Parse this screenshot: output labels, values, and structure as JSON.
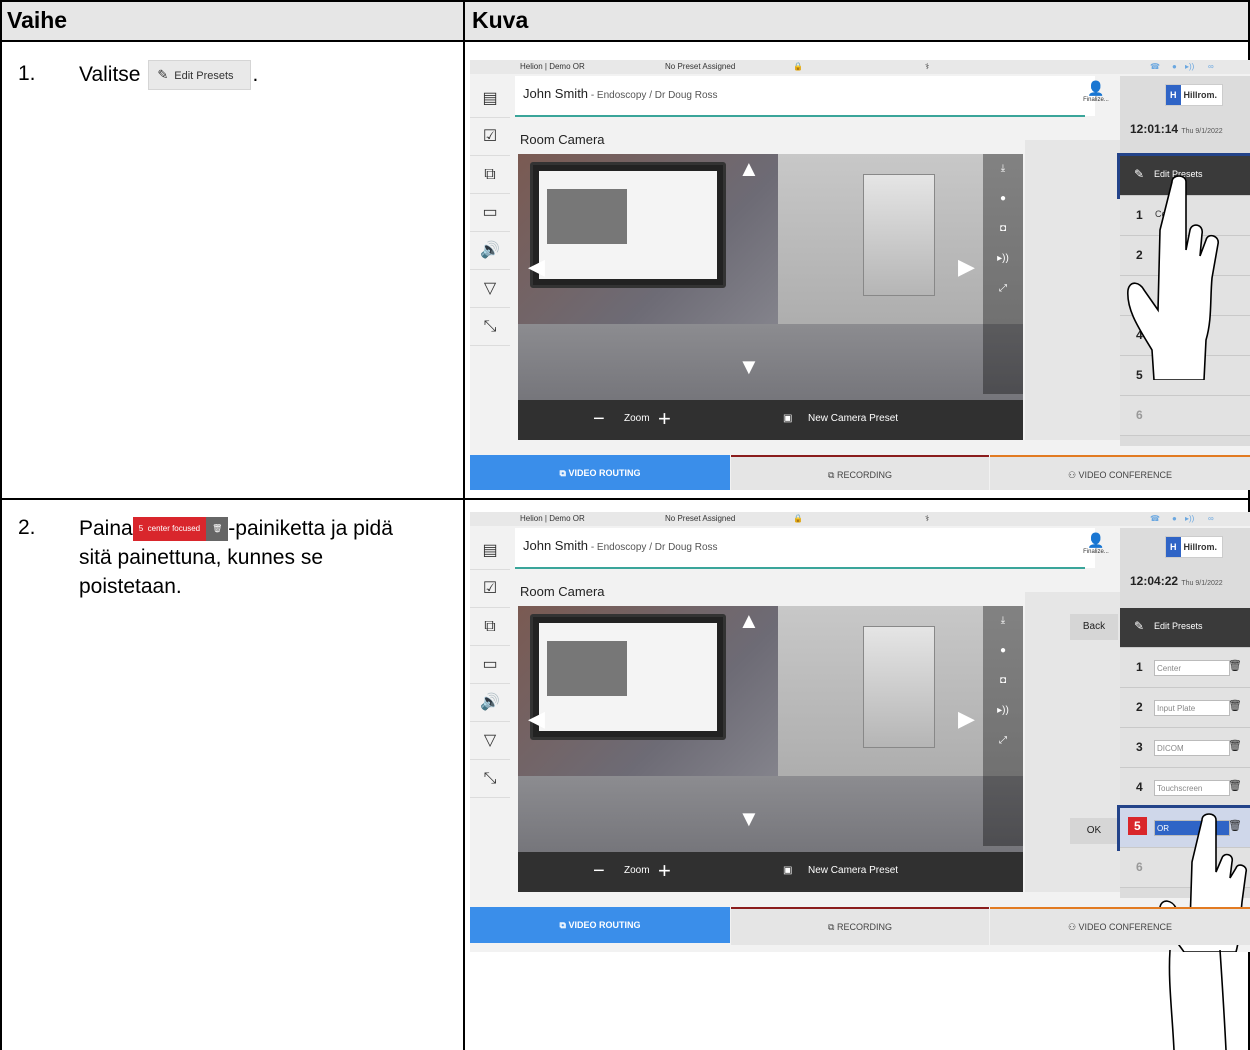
{
  "table": {
    "col1_header": "Vaihe",
    "col2_header": "Kuva"
  },
  "steps": [
    {
      "num": "1.",
      "text_before": "Valitse",
      "button_label": "Edit Presets",
      "text_after": "."
    },
    {
      "num": "2.",
      "text_before": "Paina",
      "button_number": "5",
      "button_label": "center focused",
      "text_after_line1": "-painiketta ja pidä",
      "text_line2": "sitä painettuna, kunnes se",
      "text_line3": "poistetaan."
    }
  ],
  "screens": [
    {
      "location": "Helion | Demo OR",
      "preset_status": "No Preset Assigned",
      "patient": "John Smith",
      "procedure": " - Endoscopy / Dr Doug Ross",
      "finalize": "Finalize...",
      "badge": "6",
      "logo": "Hillrom.",
      "time": "12:01:14",
      "date": "Thu 9/1/2022",
      "room_camera": "Room Camera",
      "zoom": "Zoom",
      "new_preset": "New Camera Preset",
      "edit_presets": "Edit Presets",
      "presets": [
        "Cen",
        "",
        "",
        "",
        "",
        ""
      ],
      "preset_nums": [
        "1",
        "2",
        "3",
        "4",
        "5",
        "6"
      ],
      "tabs": [
        "VIDEO ROUTING",
        "RECORDING",
        "VIDEO CONFERENCE"
      ]
    },
    {
      "location": "Helion | Demo OR",
      "preset_status": "No Preset Assigned",
      "patient": "John Smith",
      "procedure": " - Endoscopy / Dr Doug Ross",
      "finalize": "Finalize...",
      "badge": "6",
      "logo": "Hillrom.",
      "time": "12:04:22",
      "date": "Thu 9/1/2022",
      "room_camera": "Room Camera",
      "zoom": "Zoom",
      "new_preset": "New Camera Preset",
      "edit_presets": "Edit Presets",
      "back": "Back",
      "ok": "OK",
      "presets": [
        "Center",
        "Input Plate",
        "DICOM",
        "Touchscreen",
        "OR",
        ""
      ],
      "preset_nums": [
        "1",
        "2",
        "3",
        "4",
        "5",
        "6"
      ],
      "tabs": [
        "VIDEO ROUTING",
        "RECORDING",
        "VIDEO CONFERENCE"
      ]
    }
  ],
  "colors": {
    "header_bg": "#e6e6e6",
    "active_tab": "#3a8eea",
    "teal": "#3aa59a",
    "red": "#d9262c",
    "highlight": "#234389"
  }
}
